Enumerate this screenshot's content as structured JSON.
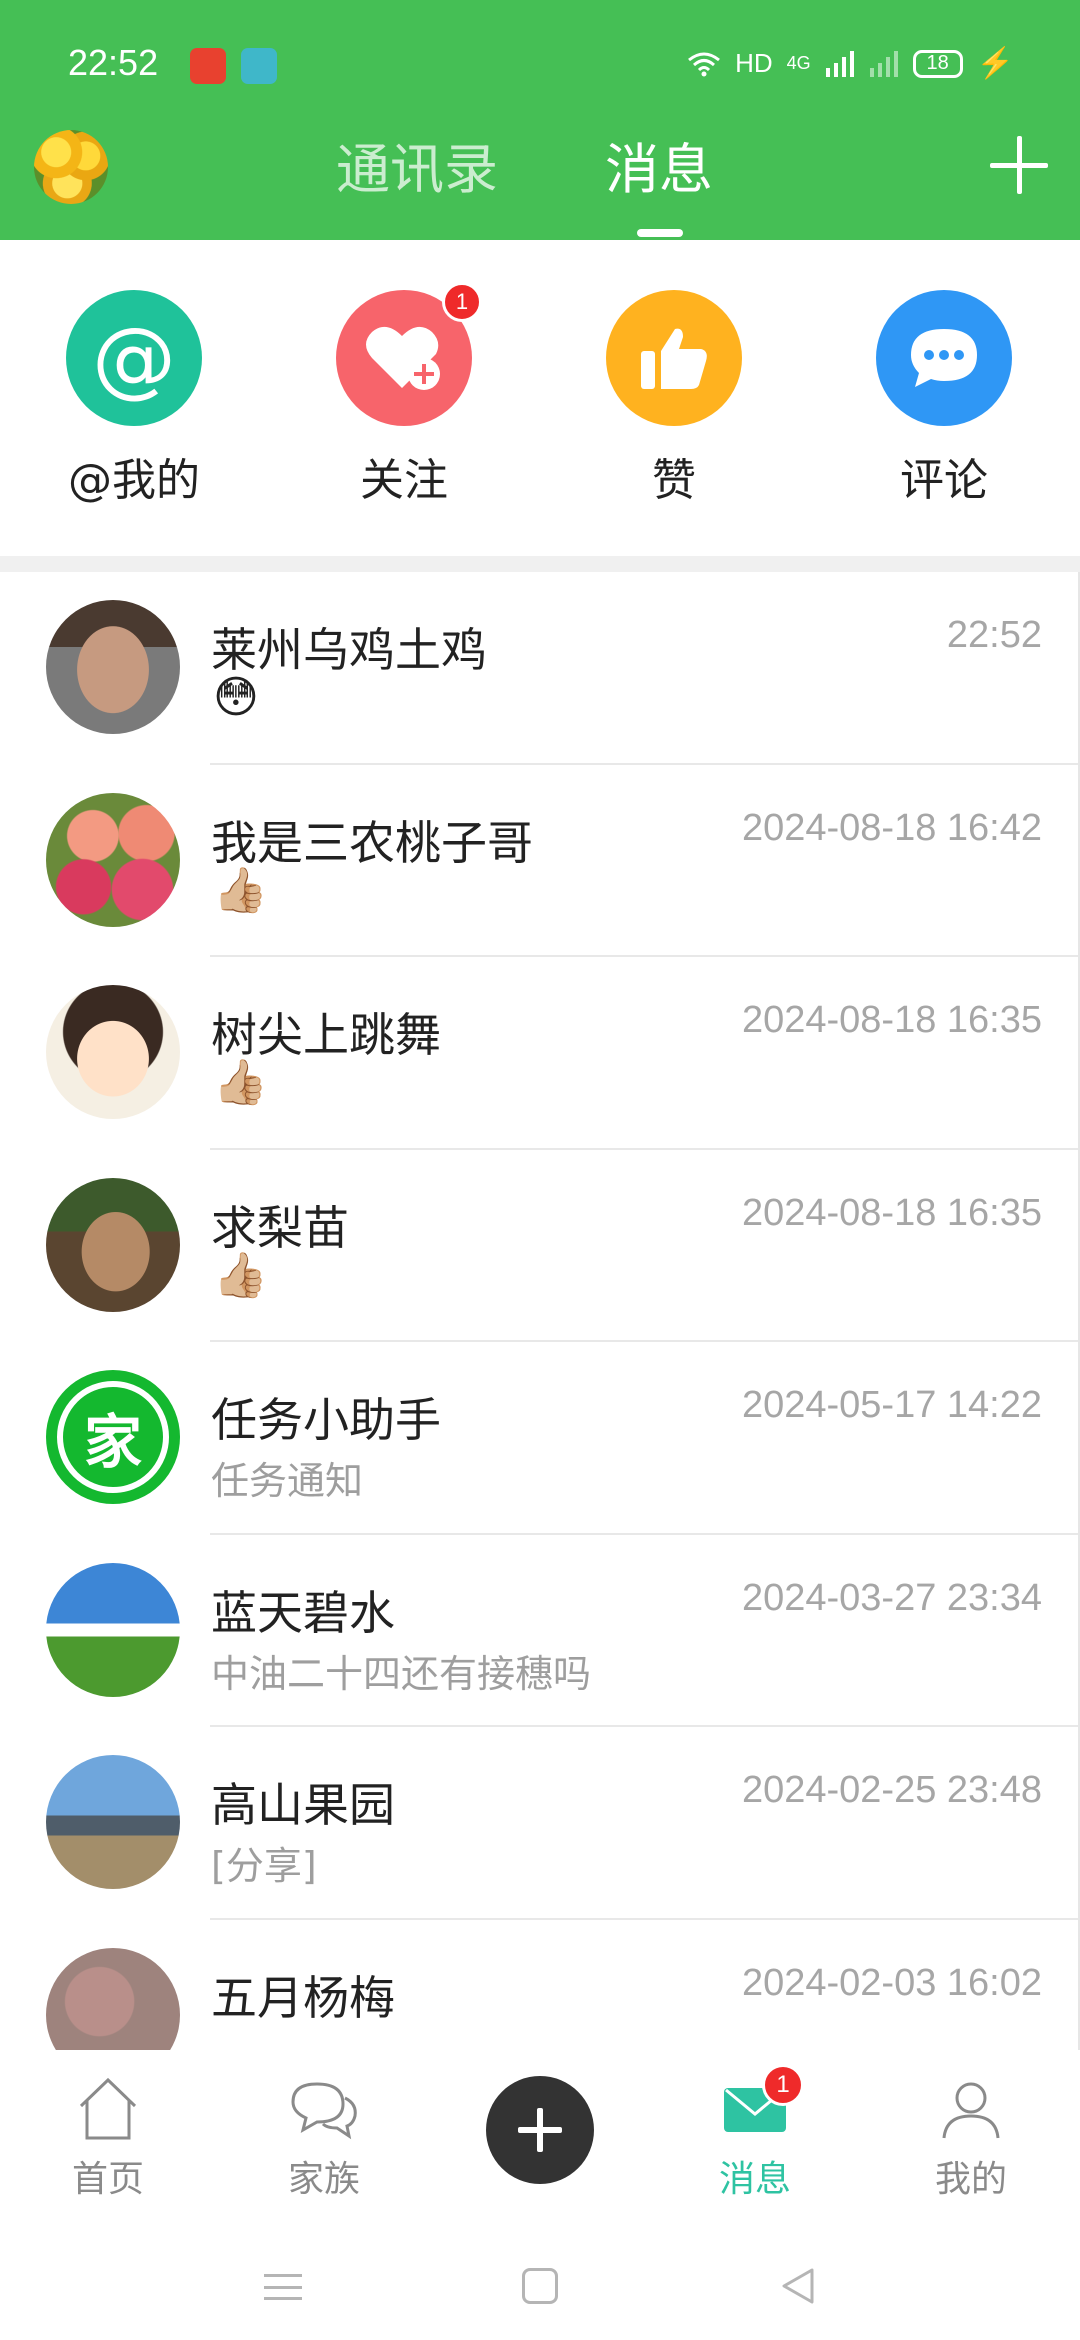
{
  "status_bar": {
    "time": "22:52",
    "network": "HD",
    "signal": "4G",
    "battery": "18"
  },
  "header": {
    "tabs": [
      {
        "label": "通讯录",
        "active": false
      },
      {
        "label": "消息",
        "active": true
      }
    ],
    "add_icon": "plus-icon",
    "background": "#45bf55"
  },
  "quick_actions": [
    {
      "label": "@我的",
      "icon": "at-icon",
      "color": "#1fc29a"
    },
    {
      "label": "关注",
      "icon": "heart-plus-icon",
      "color": "#f7646b",
      "badge": "1"
    },
    {
      "label": "赞",
      "icon": "thumbs-up-icon",
      "color": "#ffb21f"
    },
    {
      "label": "评论",
      "icon": "chat-bubble-icon",
      "color": "#2f97f5"
    }
  ],
  "messages": [
    {
      "name": "莱州乌鸡土鸡",
      "time": "22:52",
      "preview": "",
      "emoji": "😳"
    },
    {
      "name": "我是三农桃子哥",
      "time": "2024-08-18 16:42",
      "preview": "",
      "emoji": "👍🏼"
    },
    {
      "name": "树尖上跳舞",
      "time": "2024-08-18 16:35",
      "preview": "",
      "emoji": "👍🏼"
    },
    {
      "name": "求梨苗",
      "time": "2024-08-18 16:35",
      "preview": "",
      "emoji": "👍🏼"
    },
    {
      "name": "任务小助手",
      "time": "2024-05-17 14:22",
      "preview": "任务通知",
      "emoji": ""
    },
    {
      "name": "蓝天碧水",
      "time": "2024-03-27 23:34",
      "preview": "中油二十四还有接穗吗",
      "emoji": ""
    },
    {
      "name": "高山果园",
      "time": "2024-02-25 23:48",
      "preview": "[分享]",
      "emoji": ""
    },
    {
      "name": "五月杨梅",
      "time": "2024-02-03 16:02",
      "preview": "",
      "emoji": ""
    }
  ],
  "helper_avatar_glyph": "家",
  "bottom_nav": {
    "items": [
      {
        "label": "首页",
        "icon": "home-icon"
      },
      {
        "label": "家族",
        "icon": "chat-bubbles-icon"
      },
      {
        "label": "消息",
        "icon": "mail-icon",
        "active": true,
        "badge": "1"
      },
      {
        "label": "我的",
        "icon": "person-icon"
      }
    ],
    "center_icon": "add-icon",
    "active_color": "#2ec3a2"
  }
}
